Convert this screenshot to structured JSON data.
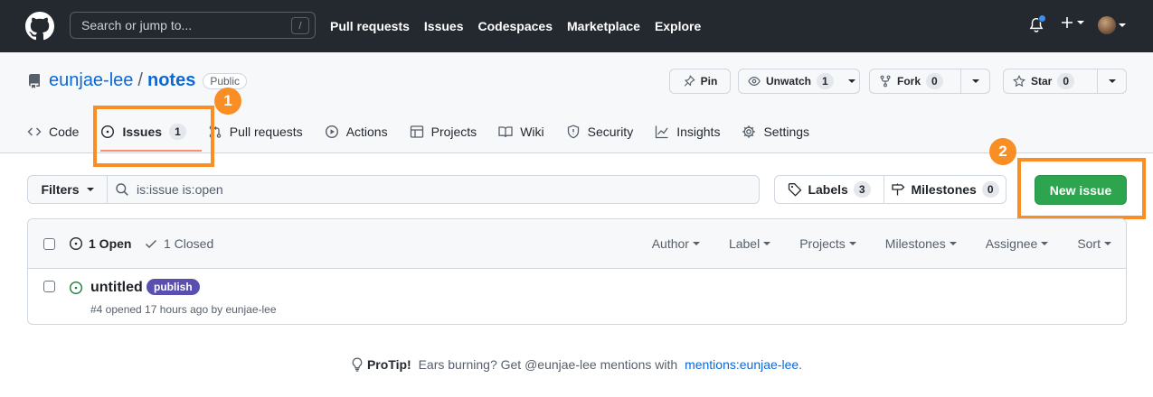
{
  "topbar": {
    "search_placeholder": "Search or jump to...",
    "search_shortcut": "/",
    "nav": [
      "Pull requests",
      "Issues",
      "Codespaces",
      "Marketplace",
      "Explore"
    ]
  },
  "repo": {
    "owner": "eunjae-lee",
    "separator": "/",
    "name": "notes",
    "visibility": "Public",
    "pin_label": "Pin",
    "unwatch_label": "Unwatch",
    "unwatch_count": "1",
    "fork_label": "Fork",
    "fork_count": "0",
    "star_label": "Star",
    "star_count": "0"
  },
  "tabs": {
    "code": "Code",
    "issues": "Issues",
    "issues_count": "1",
    "pull_requests": "Pull requests",
    "actions": "Actions",
    "projects": "Projects",
    "wiki": "Wiki",
    "security": "Security",
    "insights": "Insights",
    "settings": "Settings"
  },
  "annotations": {
    "step1": "1",
    "step2": "2",
    "color": "#f98e25"
  },
  "toolbar": {
    "filters_label": "Filters",
    "query": "is:issue is:open",
    "labels_label": "Labels",
    "labels_count": "3",
    "milestones_label": "Milestones",
    "milestones_count": "0",
    "new_issue_label": "New issue"
  },
  "issues_header": {
    "open_label": "1 Open",
    "closed_label": "1 Closed",
    "sorters": [
      "Author",
      "Label",
      "Projects",
      "Milestones",
      "Assignee",
      "Sort"
    ]
  },
  "issues": [
    {
      "title": "untitled",
      "label": "publish",
      "label_color": "#5a4fae",
      "meta": "#4 opened 17 hours ago by eunjae-lee"
    }
  ],
  "protip": {
    "prefix": "ProTip!",
    "text": " Ears burning? Get @eunjae-lee mentions with ",
    "link": "mentions:eunjae-lee",
    "suffix": "."
  },
  "colors": {
    "header_bg": "#24292f",
    "primary_green": "#2da44e",
    "link_blue": "#0969da",
    "tab_underline": "#fd8c73",
    "open_icon_green": "#1a7f37"
  }
}
